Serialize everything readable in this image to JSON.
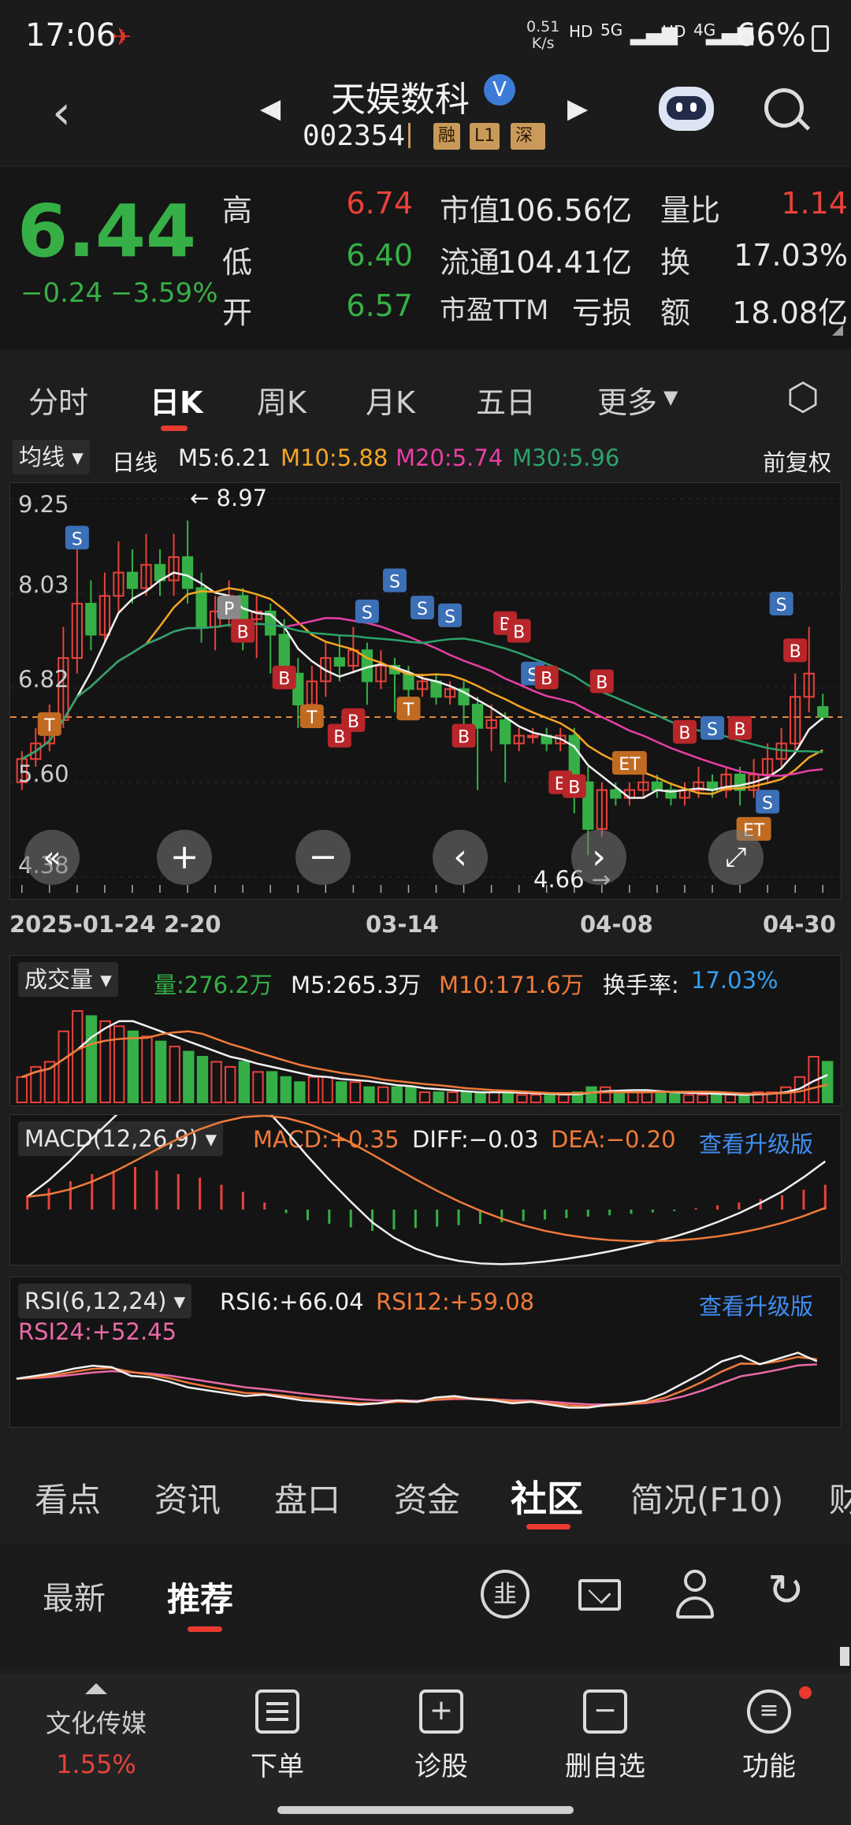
{
  "status_bar": {
    "time": "17:06",
    "net_speed_value": "0.51",
    "net_speed_unit": "K/s",
    "sig1": "HD",
    "sig2": "5G",
    "sig3": "HD",
    "sig4": "4G",
    "battery": "66%"
  },
  "header": {
    "stock_name": "天娱数科",
    "verified_mark": "V",
    "stock_code": "002354",
    "tags": [
      "融",
      "L1",
      "深股"
    ]
  },
  "quote": {
    "price": "6.44",
    "change": "−0.24",
    "change_pct": "−3.59%",
    "rows": [
      {
        "l1": "高",
        "v1": "6.74",
        "l2": "市值",
        "v2": "106.56亿",
        "l3": "量比",
        "v3": "1.14"
      },
      {
        "l1": "低",
        "v1": "6.40",
        "l2": "流通",
        "v2": "104.41亿",
        "l3": "换",
        "v3": "17.03%"
      },
      {
        "l1": "开",
        "v1": "6.57",
        "l2": "市盈TTM",
        "v2": "亏损",
        "l3": "额",
        "v3": "18.08亿"
      }
    ],
    "colors": {
      "up": "#e9423a",
      "down": "#36b046"
    }
  },
  "period_tabs": [
    "分时",
    "日K",
    "周K",
    "月K",
    "五日",
    "更多"
  ],
  "kline": {
    "ma_dropdown": "均线",
    "period_label": "日线",
    "ma5": "M5:6.21",
    "ma10": "M10:5.88",
    "ma20": "M20:5.74",
    "ma30": "M30:5.96",
    "adjust": "前复权",
    "y_labels": [
      "9.25",
      "8.03",
      "6.82",
      "5.60",
      "4.38"
    ],
    "high_mark": "8.97",
    "low_mark": "4.66",
    "x_labels": [
      "2025-01-24",
      "2-20",
      "03-14",
      "04-08",
      "04-30"
    ]
  },
  "volume": {
    "dropdown": "成交量",
    "vol": "量:276.2万",
    "m5": "M5:265.3万",
    "m10": "M10:171.6万",
    "turnover_label": "换手率:",
    "turnover_value": "17.03%"
  },
  "macd": {
    "dropdown": "MACD(12,26,9)",
    "macd": "MACD:+0.35",
    "diff": "DIFF:−0.03",
    "dea": "DEA:−0.20",
    "upgrade": "查看升级版"
  },
  "rsi": {
    "dropdown": "RSI(6,12,24)",
    "rsi6": "RSI6:+66.04",
    "rsi12": "RSI12:+59.08",
    "rsi24": "RSI24:+52.45",
    "upgrade": "查看升级版"
  },
  "info_tabs": [
    "看点",
    "资讯",
    "盘口",
    "资金",
    "社区",
    "简况(F10)",
    "财"
  ],
  "sub_tabs": [
    "最新",
    "推荐"
  ],
  "bottom_bar": {
    "sector_name": "文化传媒",
    "sector_pct": "1.55%",
    "items": [
      "下单",
      "诊股",
      "删自选",
      "功能"
    ]
  },
  "chart_data": {
    "type": "candlestick",
    "title": "",
    "x_labels": [
      "2025-01-24",
      "2-20",
      "03-14",
      "04-08",
      "04-30"
    ],
    "ylim": [
      4.38,
      9.25
    ],
    "y_ticks": [
      9.25,
      8.03,
      6.82,
      5.6,
      4.38
    ],
    "annotations": {
      "high": 8.97,
      "low": 4.66,
      "last_close": 6.44
    },
    "candles": [
      {
        "o": 5.6,
        "c": 5.9,
        "h": 6.0,
        "l": 5.5
      },
      {
        "o": 5.9,
        "c": 6.1,
        "h": 6.3,
        "l": 5.8
      },
      {
        "o": 6.1,
        "c": 6.4,
        "h": 6.6,
        "l": 6.0
      },
      {
        "o": 6.4,
        "c": 7.2,
        "h": 7.6,
        "l": 6.3
      },
      {
        "o": 7.2,
        "c": 7.9,
        "h": 8.6,
        "l": 7.0
      },
      {
        "o": 7.9,
        "c": 7.5,
        "h": 8.2,
        "l": 7.3
      },
      {
        "o": 7.5,
        "c": 8.0,
        "h": 8.3,
        "l": 7.4
      },
      {
        "o": 8.0,
        "c": 8.3,
        "h": 8.7,
        "l": 7.8
      },
      {
        "o": 8.3,
        "c": 8.1,
        "h": 8.6,
        "l": 7.9
      },
      {
        "o": 8.1,
        "c": 8.4,
        "h": 8.8,
        "l": 8.0
      },
      {
        "o": 8.4,
        "c": 8.2,
        "h": 8.6,
        "l": 8.0
      },
      {
        "o": 8.2,
        "c": 8.5,
        "h": 8.8,
        "l": 8.0
      },
      {
        "o": 8.5,
        "c": 8.1,
        "h": 8.97,
        "l": 7.9
      },
      {
        "o": 8.1,
        "c": 7.6,
        "h": 8.3,
        "l": 7.4
      },
      {
        "o": 7.6,
        "c": 7.8,
        "h": 8.0,
        "l": 7.3
      },
      {
        "o": 7.8,
        "c": 8.0,
        "h": 8.2,
        "l": 7.6
      },
      {
        "o": 8.0,
        "c": 7.7,
        "h": 8.1,
        "l": 7.3
      },
      {
        "o": 7.7,
        "c": 7.8,
        "h": 8.0,
        "l": 7.2
      },
      {
        "o": 7.8,
        "c": 7.5,
        "h": 7.9,
        "l": 7.0
      },
      {
        "o": 7.5,
        "c": 7.0,
        "h": 7.7,
        "l": 6.8
      },
      {
        "o": 7.0,
        "c": 6.6,
        "h": 7.2,
        "l": 6.3
      },
      {
        "o": 6.6,
        "c": 6.9,
        "h": 7.1,
        "l": 6.5
      },
      {
        "o": 6.9,
        "c": 7.2,
        "h": 7.4,
        "l": 6.7
      },
      {
        "o": 7.2,
        "c": 7.1,
        "h": 7.5,
        "l": 6.9
      },
      {
        "o": 7.1,
        "c": 7.3,
        "h": 7.6,
        "l": 7.0
      },
      {
        "o": 7.3,
        "c": 6.9,
        "h": 7.4,
        "l": 6.6
      },
      {
        "o": 6.9,
        "c": 7.1,
        "h": 7.3,
        "l": 6.8
      },
      {
        "o": 7.1,
        "c": 7.0,
        "h": 7.2,
        "l": 6.5
      },
      {
        "o": 7.0,
        "c": 6.8,
        "h": 7.1,
        "l": 6.6
      },
      {
        "o": 6.8,
        "c": 6.9,
        "h": 7.0,
        "l": 6.7
      },
      {
        "o": 6.9,
        "c": 6.7,
        "h": 7.0,
        "l": 6.6
      },
      {
        "o": 6.7,
        "c": 6.8,
        "h": 6.9,
        "l": 6.6
      },
      {
        "o": 6.8,
        "c": 6.6,
        "h": 6.9,
        "l": 6.3
      },
      {
        "o": 6.6,
        "c": 6.3,
        "h": 6.7,
        "l": 5.5
      },
      {
        "o": 6.3,
        "c": 6.4,
        "h": 6.6,
        "l": 6.0
      },
      {
        "o": 6.4,
        "c": 6.1,
        "h": 6.5,
        "l": 5.6
      },
      {
        "o": 6.1,
        "c": 6.2,
        "h": 6.3,
        "l": 6.0
      },
      {
        "o": 6.2,
        "c": 6.2,
        "h": 6.3,
        "l": 6.1
      },
      {
        "o": 6.2,
        "c": 6.1,
        "h": 6.3,
        "l": 6.0
      },
      {
        "o": 6.1,
        "c": 6.2,
        "h": 6.3,
        "l": 6.0
      },
      {
        "o": 6.2,
        "c": 5.6,
        "h": 6.3,
        "l": 5.2
      },
      {
        "o": 5.6,
        "c": 5.0,
        "h": 5.8,
        "l": 4.66
      },
      {
        "o": 5.0,
        "c": 5.5,
        "h": 5.6,
        "l": 4.9
      },
      {
        "o": 5.5,
        "c": 5.4,
        "h": 5.6,
        "l": 5.3
      },
      {
        "o": 5.4,
        "c": 5.5,
        "h": 5.6,
        "l": 5.3
      },
      {
        "o": 5.5,
        "c": 5.6,
        "h": 5.7,
        "l": 5.4
      },
      {
        "o": 5.6,
        "c": 5.5,
        "h": 5.7,
        "l": 5.4
      },
      {
        "o": 5.5,
        "c": 5.4,
        "h": 5.6,
        "l": 5.3
      },
      {
        "o": 5.4,
        "c": 5.5,
        "h": 5.6,
        "l": 5.3
      },
      {
        "o": 5.5,
        "c": 5.6,
        "h": 5.8,
        "l": 5.4
      },
      {
        "o": 5.6,
        "c": 5.5,
        "h": 5.7,
        "l": 5.4
      },
      {
        "o": 5.5,
        "c": 5.7,
        "h": 5.8,
        "l": 5.4
      },
      {
        "o": 5.7,
        "c": 5.5,
        "h": 5.8,
        "l": 5.3
      },
      {
        "o": 5.5,
        "c": 5.7,
        "h": 5.9,
        "l": 5.4
      },
      {
        "o": 5.7,
        "c": 5.9,
        "h": 6.1,
        "l": 5.6
      },
      {
        "o": 5.9,
        "c": 6.1,
        "h": 6.3,
        "l": 5.8
      },
      {
        "o": 6.1,
        "c": 6.7,
        "h": 7.0,
        "l": 6.0
      },
      {
        "o": 6.7,
        "c": 7.0,
        "h": 7.6,
        "l": 6.5
      },
      {
        "o": 6.57,
        "c": 6.44,
        "h": 6.74,
        "l": 6.4
      }
    ],
    "signals": [
      {
        "t": "S",
        "i": 4,
        "p": 8.75
      },
      {
        "t": "T",
        "i": 2,
        "p": 6.35
      },
      {
        "t": "P",
        "i": 15,
        "p": 7.85
      },
      {
        "t": "B",
        "i": 16,
        "p": 7.55
      },
      {
        "t": "B",
        "i": 19,
        "p": 6.95
      },
      {
        "t": "T",
        "i": 21,
        "p": 6.45
      },
      {
        "t": "B",
        "i": 23,
        "p": 6.2
      },
      {
        "t": "B",
        "i": 24,
        "p": 6.4
      },
      {
        "t": "S",
        "i": 25,
        "p": 7.8
      },
      {
        "t": "S",
        "i": 27,
        "p": 8.2
      },
      {
        "t": "T",
        "i": 28,
        "p": 6.55
      },
      {
        "t": "S",
        "i": 29,
        "p": 7.85
      },
      {
        "t": "S",
        "i": 31,
        "p": 7.75
      },
      {
        "t": "B",
        "i": 32,
        "p": 6.2
      },
      {
        "t": "B",
        "i": 35,
        "p": 7.65
      },
      {
        "t": "B",
        "i": 36,
        "p": 7.55
      },
      {
        "t": "S",
        "i": 37,
        "p": 7.0
      },
      {
        "t": "B",
        "i": 38,
        "p": 6.95
      },
      {
        "t": "B",
        "i": 39,
        "p": 5.6
      },
      {
        "t": "B",
        "i": 40,
        "p": 5.55
      },
      {
        "t": "B",
        "i": 42,
        "p": 6.9
      },
      {
        "t": "ET",
        "i": 44,
        "p": 5.85
      },
      {
        "t": "B",
        "i": 48,
        "p": 6.25
      },
      {
        "t": "S",
        "i": 50,
        "p": 6.3
      },
      {
        "t": "B",
        "i": 52,
        "p": 6.3
      },
      {
        "t": "ET",
        "i": 53,
        "p": 5.0
      },
      {
        "t": "S",
        "i": 54,
        "p": 5.35
      },
      {
        "t": "S",
        "i": 55,
        "p": 7.9
      },
      {
        "t": "B",
        "i": 56,
        "p": 7.3
      }
    ],
    "volume": [
      5,
      7,
      8,
      14,
      18,
      17,
      16,
      15,
      14,
      13,
      12,
      11,
      10,
      9,
      8,
      7,
      8,
      6,
      6,
      5,
      4,
      5,
      5,
      4,
      4,
      3,
      3,
      3,
      3,
      2,
      2,
      2,
      2,
      2,
      2,
      2,
      1.5,
      1.5,
      1.5,
      1.5,
      2,
      3,
      3,
      2,
      2,
      2,
      2,
      2,
      1.5,
      1.5,
      1.5,
      1.5,
      1.5,
      2,
      2,
      3,
      5,
      9,
      8
    ],
    "rsi6": [
      48,
      50,
      52,
      55,
      57,
      56,
      50,
      49,
      46,
      42,
      40,
      38,
      36,
      37,
      35,
      33,
      32,
      31,
      30,
      31,
      33,
      32,
      35,
      36,
      34,
      33,
      31,
      32,
      30,
      28,
      28,
      30,
      31,
      33,
      38,
      45,
      52,
      60,
      64,
      58,
      62,
      66,
      60
    ],
    "macd_hist": [
      0.2,
      0.3,
      0.4,
      0.5,
      0.55,
      0.6,
      0.55,
      0.5,
      0.45,
      0.35,
      0.25,
      0.1,
      -0.05,
      -0.15,
      -0.2,
      -0.25,
      -0.3,
      -0.28,
      -0.26,
      -0.24,
      -0.22,
      -0.2,
      -0.18,
      -0.16,
      -0.14,
      -0.12,
      -0.1,
      -0.08,
      -0.06,
      -0.04,
      -0.02,
      0.02,
      0.06,
      0.1,
      0.15,
      0.2,
      0.28,
      0.35
    ]
  }
}
